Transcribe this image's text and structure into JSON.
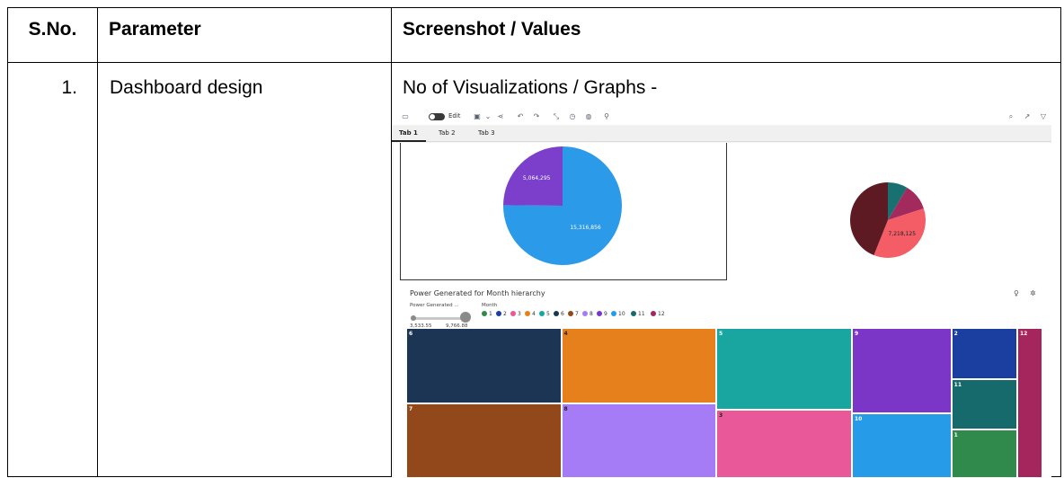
{
  "table": {
    "headers": {
      "sno": "S.No.",
      "parameter": "Parameter",
      "values": "Screenshot / Values"
    },
    "row": {
      "sno": "1.",
      "parameter": "Dashboard design",
      "values_title": "No of Visualizations / Graphs -"
    }
  },
  "dashboard": {
    "toolbar": {
      "edit_label": "Edit",
      "icons": [
        "comment-icon",
        "edit-toggle",
        "save-icon",
        "chevron-down-icon",
        "share-icon",
        "undo-icon",
        "redo-icon",
        "auto-layout-icon",
        "timer-icon",
        "palette-icon",
        "pin-icon",
        "zoom-icon",
        "chart-icon",
        "filter-icon"
      ]
    },
    "tabs": [
      "Tab 1",
      "Tab 2",
      "Tab 3"
    ],
    "active_tab": "Tab 1",
    "treemap": {
      "title": "Power Generated for Month hierarchy",
      "size_legend_label": "Power Generated ...",
      "size_min": "3,533.55",
      "size_max": "9,766.88",
      "color_legend_label": "Month"
    },
    "legend_items": [
      {
        "label": "1",
        "color": "#2f8a4c"
      },
      {
        "label": "2",
        "color": "#1b3fa0"
      },
      {
        "label": "3",
        "color": "#e9599a"
      },
      {
        "label": "4",
        "color": "#e5801c"
      },
      {
        "label": "5",
        "color": "#1aa6a0"
      },
      {
        "label": "6",
        "color": "#1c3554"
      },
      {
        "label": "7",
        "color": "#93481b"
      },
      {
        "label": "8",
        "color": "#a57cf6"
      },
      {
        "label": "9",
        "color": "#7b36c8"
      },
      {
        "label": "10",
        "color": "#269ce9"
      },
      {
        "label": "11",
        "color": "#176a6c"
      },
      {
        "label": "12",
        "color": "#a5255d"
      }
    ]
  },
  "chart_data": [
    {
      "type": "pie",
      "slices": [
        {
          "label": "15,316,856",
          "value": 15316856,
          "color": "#2b9ae8"
        },
        {
          "label": "5,064,295",
          "value": 5064295,
          "color": "#7b3fcb"
        }
      ]
    },
    {
      "type": "pie",
      "slices": [
        {
          "label": "",
          "value": 1700000,
          "color": "#197070"
        },
        {
          "label": "",
          "value": 2300000,
          "color": "#a32a5d"
        },
        {
          "label": "7,218,125",
          "value": 7218125,
          "color": "#f45d66"
        },
        {
          "label": "",
          "value": 8800000,
          "color": "#5e1a22"
        }
      ]
    },
    {
      "type": "treemap",
      "title": "Power Generated for Month hierarchy",
      "cells": [
        {
          "label": "6",
          "color": "#1c3554",
          "value": 12
        },
        {
          "label": "7",
          "color": "#93481b",
          "value": 12
        },
        {
          "label": "4",
          "color": "#e5801c",
          "value": 12
        },
        {
          "label": "8",
          "color": "#a57cf6",
          "value": 12
        },
        {
          "label": "5",
          "color": "#1aa6a0",
          "value": 11.5
        },
        {
          "label": "3",
          "color": "#e9599a",
          "value": 9.5
        },
        {
          "label": "9",
          "color": "#7b36c8",
          "value": 8.8
        },
        {
          "label": "10",
          "color": "#269ce9",
          "value": 6.6
        },
        {
          "label": "2",
          "color": "#1b3fa0",
          "value": 3.5
        },
        {
          "label": "11",
          "color": "#176a6c",
          "value": 3.4
        },
        {
          "label": "1",
          "color": "#2f8a4c",
          "value": 3.3
        },
        {
          "label": "12",
          "color": "#a5255d",
          "value": 3.9
        }
      ]
    }
  ]
}
